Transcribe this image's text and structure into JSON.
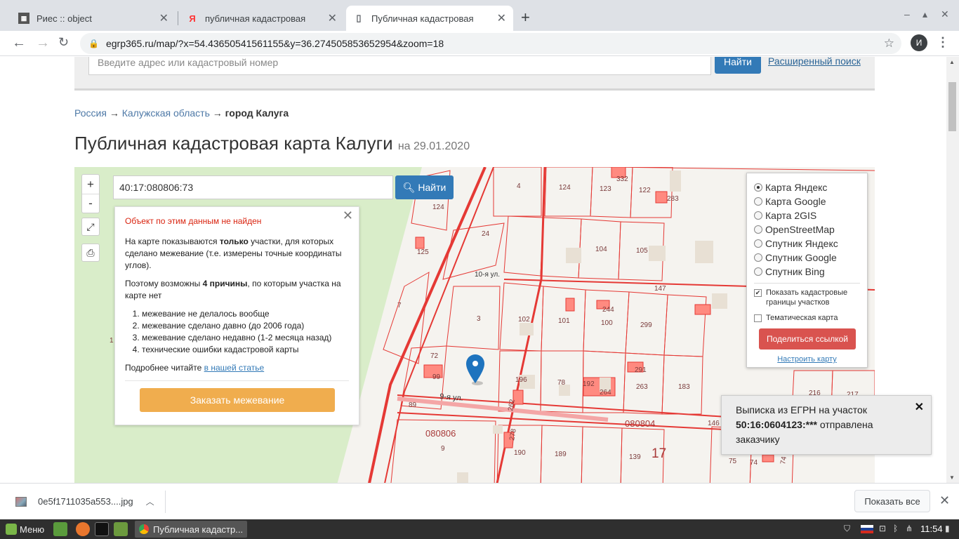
{
  "browser": {
    "tabs": [
      {
        "title": "Риес :: object"
      },
      {
        "title": "публичная кадастровая"
      },
      {
        "title": "Публичная кадастровая"
      }
    ],
    "url": "egrp365.ru/map/?x=54.43650541561155&y=36.274505853652954&zoom=18",
    "profile_initial": "И"
  },
  "site": {
    "search_placeholder": "Введите адрес или кадастровый номер",
    "search_button": "Найти",
    "advanced_search": "Расширенный поиск",
    "breadcrumbs": [
      "Россия",
      "Калужская область",
      "город Калуга"
    ],
    "title": "Публичная кадастровая карта Калуги",
    "title_date": "на 29.01.2020"
  },
  "map": {
    "cadastral_input": "40:17:080806:73",
    "find_button": "Найти",
    "zoom_in": "+",
    "zoom_out": "-",
    "popup": {
      "error": "Объект по этим данным не найден",
      "p1_before": "На карте показываются ",
      "p1_bold": "только",
      "p1_after": " участки, для которых сделано межевание (т.е. измерены точные координаты углов).",
      "p2_before": "Поэтому возможны ",
      "p2_bold": "4 причины",
      "p2_after": ", по которым участка на карте нет",
      "reasons": [
        "межевание не делалось вообще",
        "межевание сделано давно (до 2006 года)",
        "межевание сделано недавно (1-2 месяца назад)",
        "технические ошибки кадастровой карты"
      ],
      "more_text": "Подробнее читайте ",
      "more_link": "в нашей статье",
      "order_button": "Заказать межевание"
    },
    "layers": {
      "options": [
        "Карта Яндекс",
        "Карта Google",
        "Карта 2GIS",
        "OpenStreetMap",
        "Спутник Яндекс",
        "Спутник Google",
        "Спутник Bing"
      ],
      "selected": "Карта Яндекс",
      "show_borders": "Показать кадастровые границы участков",
      "thematic": "Тематическая карта",
      "share_button": "Поделиться ссылкой",
      "configure_link": "Настроить карту"
    },
    "labels": {
      "street_10": "10-я ул.",
      "street_9": "9-я ул.",
      "block_080806": "080806",
      "block_080804": "080804",
      "n17": "17",
      "plots": [
        "4",
        "124",
        "123",
        "332",
        "122",
        "283",
        "124",
        "24",
        "104",
        "105",
        "125",
        "147",
        "7",
        "3",
        "102",
        "101",
        "244",
        "100",
        "299",
        "72",
        "99",
        "196",
        "78",
        "192",
        "264",
        "291",
        "263",
        "183",
        "216",
        "217",
        "89",
        "146",
        "278",
        "190",
        "189",
        "139",
        "9",
        "75",
        "74",
        "74",
        "262",
        "1"
      ]
    }
  },
  "toast": {
    "line1": "Выписка из ЕГРН на участок",
    "cadnum": "50:16:0604123:***",
    "line2_after": " отправлена заказчику"
  },
  "downloads": {
    "file": "0e5f1711035a553....jpg",
    "show_all": "Показать все"
  },
  "taskbar": {
    "menu": "Меню",
    "task": "Публичная кадастр...",
    "time": "11:54"
  }
}
